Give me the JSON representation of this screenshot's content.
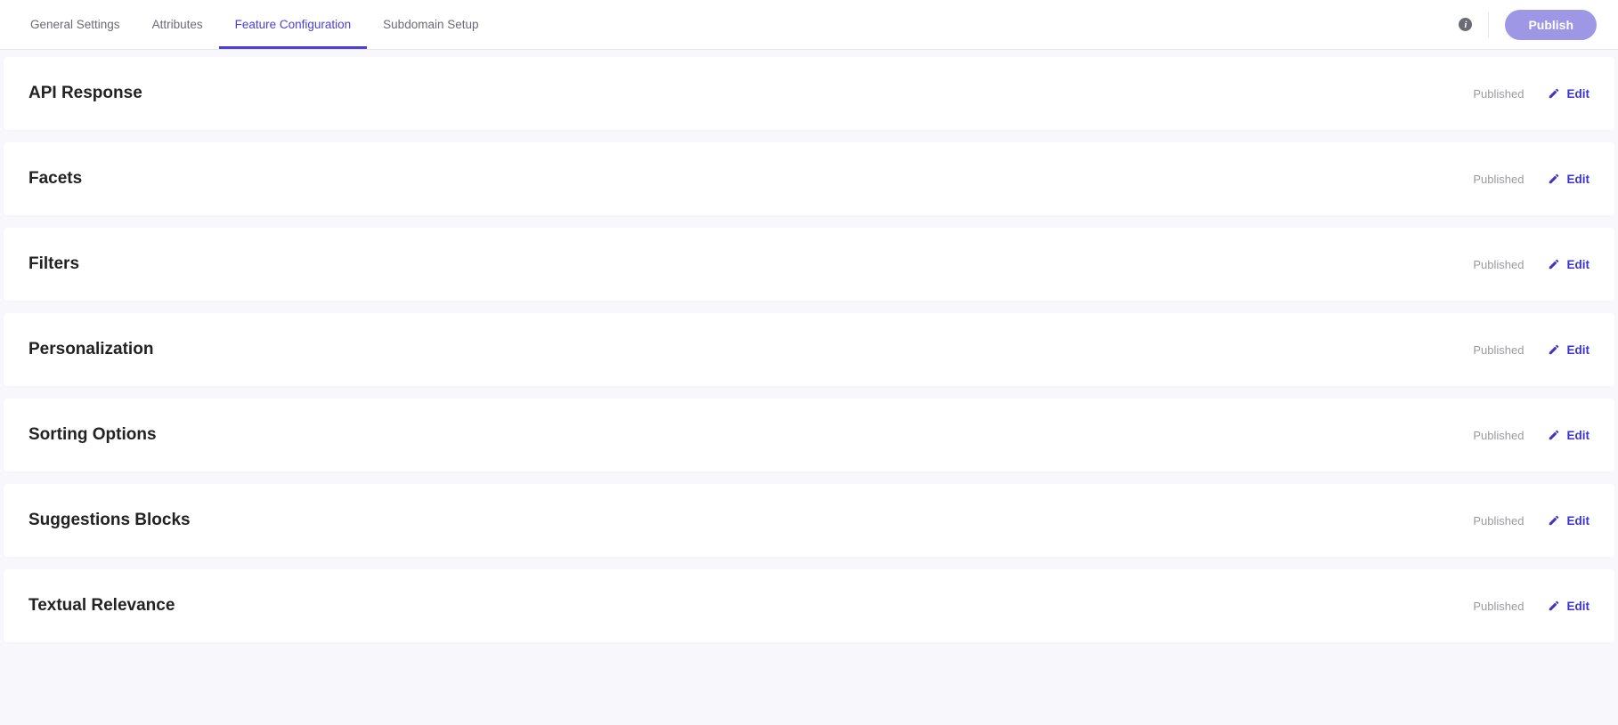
{
  "tabs": [
    {
      "label": "General Settings",
      "active": false
    },
    {
      "label": "Attributes",
      "active": false
    },
    {
      "label": "Feature Configuration",
      "active": true
    },
    {
      "label": "Subdomain Setup",
      "active": false
    }
  ],
  "publish_button": "Publish",
  "edit_label": "Edit",
  "features": [
    {
      "title": "API Response",
      "status": "Published"
    },
    {
      "title": "Facets",
      "status": "Published"
    },
    {
      "title": "Filters",
      "status": "Published"
    },
    {
      "title": "Personalization",
      "status": "Published"
    },
    {
      "title": "Sorting Options",
      "status": "Published"
    },
    {
      "title": "Suggestions Blocks",
      "status": "Published"
    },
    {
      "title": "Textual Relevance",
      "status": "Published"
    }
  ]
}
